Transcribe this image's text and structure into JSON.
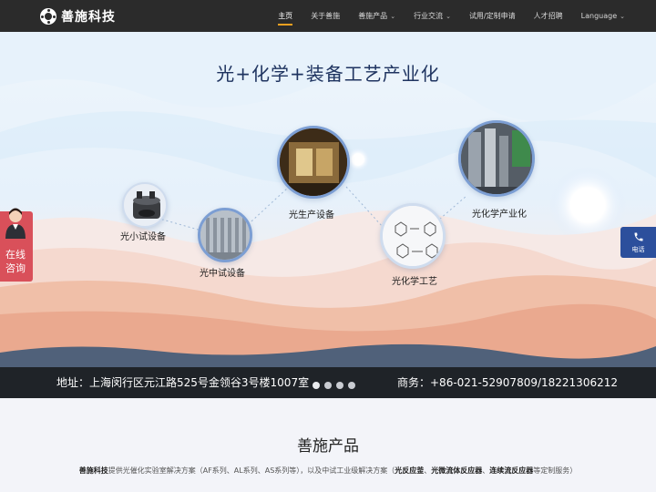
{
  "brand": {
    "name": "善施科技"
  },
  "nav": {
    "items": [
      {
        "label": "主页",
        "active": true,
        "dropdown": false
      },
      {
        "label": "关于善施",
        "active": false,
        "dropdown": false
      },
      {
        "label": "善施产品",
        "active": false,
        "dropdown": true
      },
      {
        "label": "行业交流",
        "active": false,
        "dropdown": true
      },
      {
        "label": "试用/定制申请",
        "active": false,
        "dropdown": false
      },
      {
        "label": "人才招聘",
        "active": false,
        "dropdown": false
      },
      {
        "label": "Language",
        "active": false,
        "dropdown": true
      }
    ],
    "dropdown_icon": "chevron-down-icon"
  },
  "hero": {
    "title": "光+化学+装备工艺产业化",
    "nodes": [
      {
        "label": "光小试设备"
      },
      {
        "label": "光中试设备"
      },
      {
        "label": "光生产设备"
      },
      {
        "label": "光化学工艺"
      },
      {
        "label": "光化学产业化"
      }
    ],
    "address": "地址：上海闵行区元江路525号金领谷3号楼1007室",
    "phone": "商务：+86-021-52907809/18221306212",
    "slides": 4,
    "active_slide": 1
  },
  "consult": {
    "line1": "在线",
    "line2": "咨询"
  },
  "phone_tab": {
    "label": "电话",
    "icon": "phone-icon"
  },
  "products": {
    "title": "善施产品",
    "desc_brand": "善施科技",
    "desc_part1": "提供光催化实验室解决方案（AF系列、AL系列、AS系列等），以及中试工业级解决方案（",
    "desc_b1": "光反应釜",
    "desc_sep1": "、",
    "desc_b2": "光微流体反应器",
    "desc_sep2": "、",
    "desc_b3": "连续流反应器",
    "desc_part2": "等定制服务）"
  },
  "colors": {
    "header": "#2b2b2b",
    "accent": "#f0a020",
    "consult": "#d9505a",
    "phone_tab": "#2c4f9c",
    "title": "#1f3460"
  }
}
